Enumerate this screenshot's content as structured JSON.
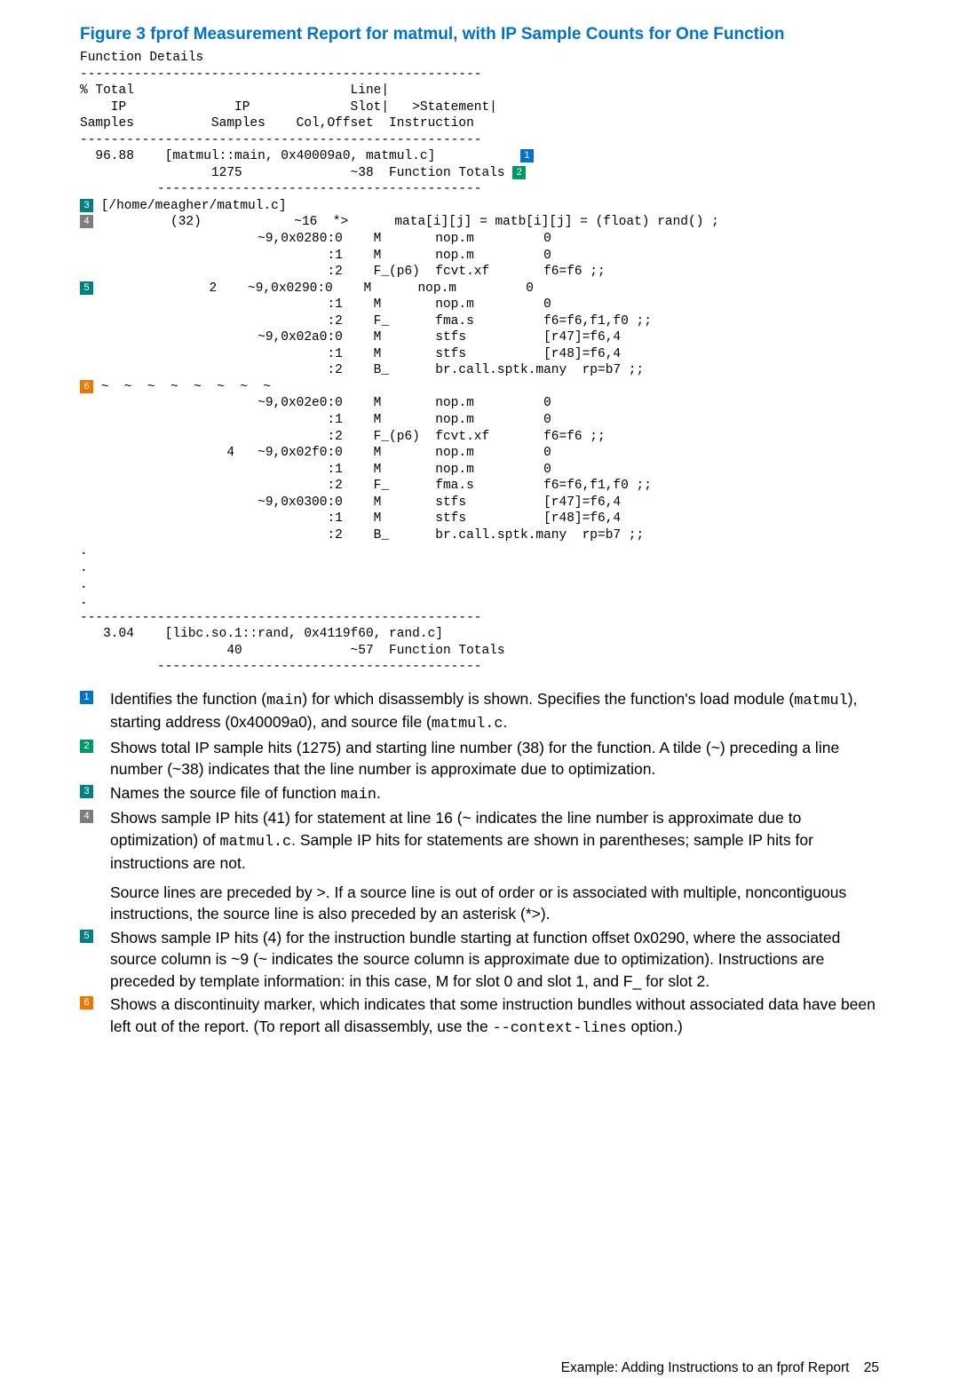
{
  "figure_title": "Figure 3 fprof Measurement Report for matmul, with IP Sample Counts for One Function",
  "report": {
    "l1": "Function Details",
    "hr": "----------------------------------------------------",
    "h1": "% Total                            Line|",
    "h2": "    IP              IP             Slot|   >Statement|",
    "h3": "Samples          Samples    Col,Offset  Instruction",
    "hr2": "----------------------------------------------------",
    "f1": "  96.88    [matmul::main, 0x40009a0, matmul.c]           ",
    "f2": "                 1275              ~38  Function Totals ",
    "sh": "          ------------------------------------------",
    "srcfile": " [/home/meagher/matmul.c]",
    "a1": "          (32)            ~16  *>      mata[i][j] = matb[i][j] = (float) rand() ;",
    "a2": "                       ~9,0x0280:0    M       nop.m         0",
    "a3": "                                :1    M       nop.m         0",
    "a4": "                                :2    F_(p6)  fcvt.xf       f6=f6 ;;",
    "b1": "               2    ~9,0x0290:0    M      nop.m         0",
    "b2": "                                :1    M       nop.m         0",
    "b3": "                                :2    F_      fma.s         f6=f6,f1,f0 ;;",
    "b4": "                       ~9,0x02a0:0    M       stfs          [r47]=f6,4",
    "b5": "                                :1    M       stfs          [r48]=f6,4",
    "b6": "                                :2    B_      br.call.sptk.many  rp=b7 ;;",
    "dis": " ~  ~  ~  ~  ~  ~  ~  ~",
    "c1": "                       ~9,0x02e0:0    M       nop.m         0",
    "c2": "                                :1    M       nop.m         0",
    "c3": "                                :2    F_(p6)  fcvt.xf       f6=f6 ;;",
    "c4": "                   4   ~9,0x02f0:0    M       nop.m         0",
    "c5": "                                :1    M       nop.m         0",
    "c6": "                                :2    F_      fma.s         f6=f6,f1,f0 ;;",
    "c7": "                       ~9,0x0300:0    M       stfs          [r47]=f6,4",
    "c8": "                                :1    M       stfs          [r48]=f6,4",
    "c9": "                                :2    B_      br.call.sptk.many  rp=b7 ;;",
    "dots": ".",
    "hr3": "----------------------------------------------------",
    "g1": "   3.04    [libc.so.1::rand, 0x4119f60, rand.c]",
    "g2": "                   40              ~57  Function Totals",
    "g3": "          ------------------------------------------"
  },
  "notes": {
    "n1a": "Identifies the function (",
    "n1b": ") for which disassembly is shown. Specifies the function's load module (",
    "n1c": "), starting address (0x40009a0), and source file (",
    "n1d": ".",
    "n1_main": "main",
    "n1_matmul": "matmul",
    "n1_matmulc": "matmul.c",
    "n2": "Shows total IP sample hits (1275) and starting line number (38) for the function. A tilde (~) preceding a line number (~38) indicates that the line number is approximate due to optimization.",
    "n3a": "Names the source file of function ",
    "n3b": ".",
    "n3_main": "main",
    "n4a": "Shows sample IP hits (41) for statement at line 16 (~ indicates the line number is approximate due to optimization) of ",
    "n4b": ". Sample IP hits for statements are shown in parentheses; sample IP hits for instructions are not.",
    "n4_matmulc": "matmul.c",
    "n4_second": "Source lines are preceded by >. If a source line is out of order or is associated with multiple, noncontiguous instructions, the source line is also preceded by an asterisk (*>).",
    "n5": "Shows sample IP hits (4) for the instruction bundle starting at function offset 0x0290, where the associated source column is ~9 (~ indicates the source column is approximate due to optimization). Instructions are preceded by template information: in this case, M for slot 0 and slot 1, and F_ for slot 2.",
    "n6a": "Shows a discontinuity marker, which indicates that some instruction bundles without associated data have been left out of the report. (To report all disassembly, use the ",
    "n6b": " option.)",
    "n6_opt": "--context-lines"
  },
  "footer": {
    "text": "Example: Adding Instructions to an fprof Report",
    "page": "25"
  }
}
